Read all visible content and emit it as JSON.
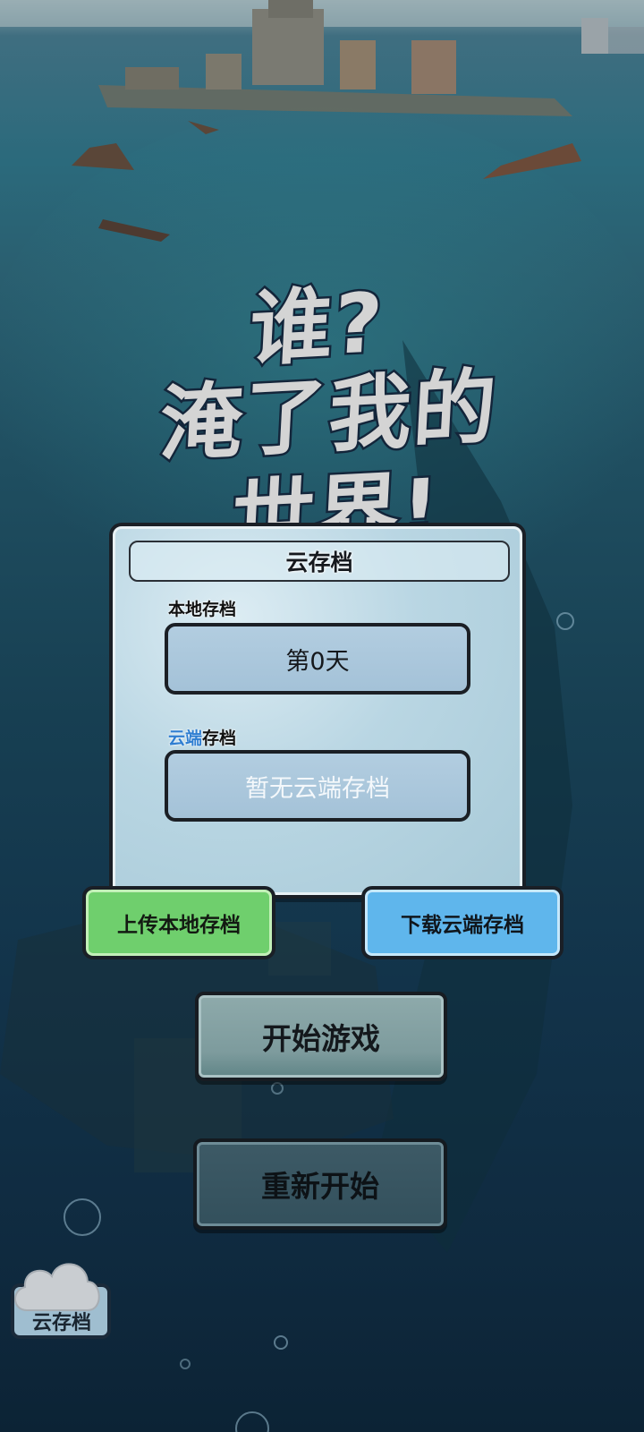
{
  "game_title": {
    "line1": "谁?",
    "line2": "淹了我的",
    "line3": "世界!"
  },
  "cloud_save_panel": {
    "header": "云存档",
    "local_label": "本地存档",
    "local_value": "第0天",
    "cloud_label_prefix": "云端",
    "cloud_label_suffix": "存档",
    "cloud_value": "暂无云端存档"
  },
  "buttons": {
    "upload": "上传本地存档",
    "download": "下载云端存档",
    "start": "开始游戏",
    "restart": "重新开始"
  },
  "cloud_save_button": {
    "label": "云存档",
    "icon": "cloud-icon"
  },
  "colors": {
    "upload_button": "#6fcf6d",
    "download_button": "#5fb6ec",
    "cloud_label_accent": "#2f7ed1"
  }
}
